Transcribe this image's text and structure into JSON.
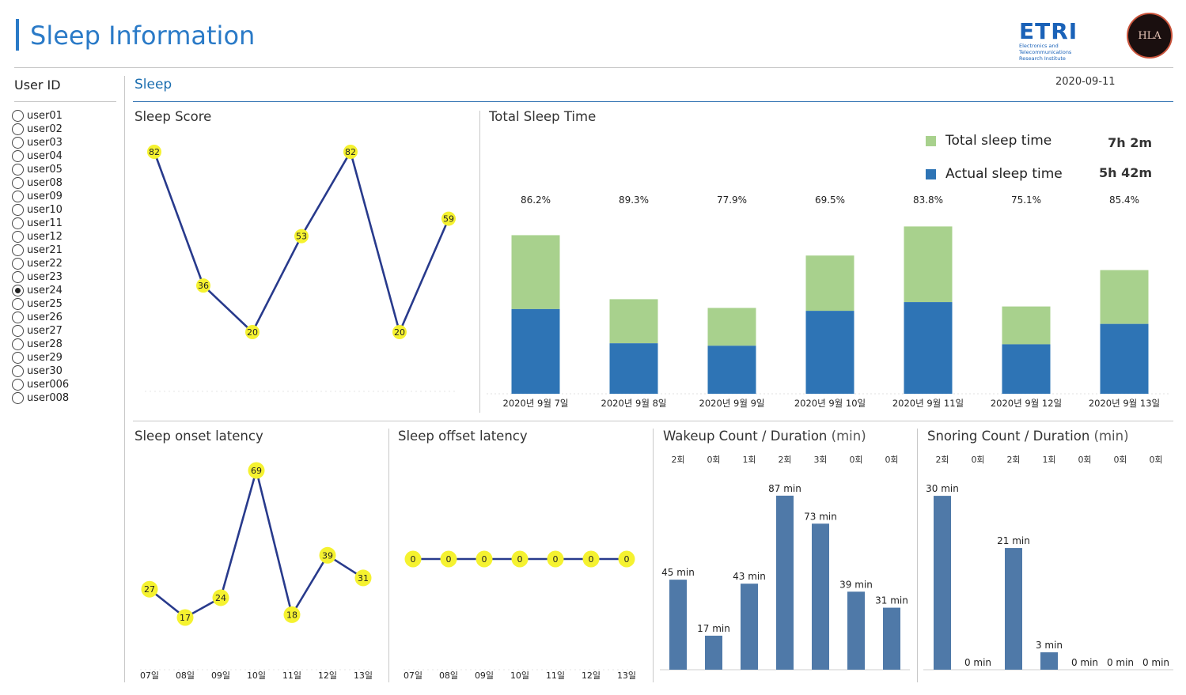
{
  "header": {
    "title": "Sleep Information",
    "logo_text": "ETRI",
    "logo_subtitle_1": "Electronics and Telecommunications",
    "logo_subtitle_2": "Research Institute",
    "brand_mark": "HLA"
  },
  "sidebar": {
    "title": "User ID",
    "selected": "user24",
    "users": [
      "user01",
      "user02",
      "user03",
      "user04",
      "user05",
      "user08",
      "user09",
      "user10",
      "user11",
      "user12",
      "user21",
      "user22",
      "user23",
      "user24",
      "user25",
      "user26",
      "user27",
      "user28",
      "user29",
      "user30",
      "user006",
      "user008"
    ]
  },
  "main": {
    "section_label": "Sleep",
    "date": "2020-09-11"
  },
  "colors": {
    "accent": "#2a7ac7",
    "line": "#283a8c",
    "marker": "#f5f230",
    "total_sleep": "#a8d18d",
    "actual_sleep": "#2e74b5",
    "bar": "#4f79a8"
  },
  "chart_data": [
    {
      "id": "sleep_score",
      "type": "line",
      "title": "Sleep Score",
      "values": [
        82,
        36,
        20,
        53,
        82,
        20,
        59
      ]
    },
    {
      "id": "total_sleep_time",
      "type": "bar",
      "title": "Total Sleep Time",
      "categories": [
        "2020년 9월 7일",
        "2020년 9월 8일",
        "2020년 9월 9일",
        "2020년 9월 10일",
        "2020년 9월 11일",
        "2020년 9월 12일",
        "2020년 9월 13일"
      ],
      "percent_labels": [
        "86.2%",
        "89.3%",
        "77.9%",
        "69.5%",
        "83.8%",
        "75.1%",
        "85.4%"
      ],
      "series": [
        {
          "name": "Actual sleep time",
          "values": [
            5.82,
            3.47,
            3.3,
            5.7,
            6.3,
            3.4,
            4.8
          ]
        },
        {
          "name": "Total sleep time",
          "values": [
            10.9,
            6.5,
            5.9,
            9.5,
            11.5,
            6.0,
            8.5
          ]
        }
      ],
      "legend": [
        {
          "name": "Total sleep time",
          "value": "7h 2m"
        },
        {
          "name": "Actual sleep time",
          "value": "5h 42m"
        }
      ],
      "legend_position": "top-right"
    },
    {
      "id": "sleep_onset_latency",
      "type": "line",
      "title": "Sleep onset latency",
      "categories": [
        "07일",
        "08일",
        "09일",
        "10일",
        "11일",
        "12일",
        "13일"
      ],
      "values": [
        27,
        17,
        24,
        69,
        18,
        39,
        31
      ]
    },
    {
      "id": "sleep_offset_latency",
      "type": "line",
      "title": "Sleep offset latency",
      "categories": [
        "07일",
        "08일",
        "09일",
        "10일",
        "11일",
        "12일",
        "13일"
      ],
      "values": [
        0,
        0,
        0,
        0,
        0,
        0,
        0
      ]
    },
    {
      "id": "wakeup",
      "type": "bar",
      "title": "Wakeup Count / Duration",
      "unit": "(min)",
      "counts": [
        "2회",
        "0회",
        "1회",
        "2회",
        "3회",
        "0회",
        "0회"
      ],
      "values": [
        45,
        17,
        43,
        87,
        73,
        39,
        31
      ],
      "value_labels": [
        "45 min",
        "17 min",
        "43 min",
        "87 min",
        "73 min",
        "39 min",
        "31 min"
      ]
    },
    {
      "id": "snoring",
      "type": "bar",
      "title": "Snoring Count / Duration",
      "unit": "(min)",
      "counts": [
        "2회",
        "0회",
        "2회",
        "1회",
        "0회",
        "0회",
        "0회"
      ],
      "values": [
        30,
        0,
        21,
        3,
        0,
        0,
        0
      ],
      "value_labels": [
        "30 min",
        "0 min",
        "21 min",
        "3 min",
        "0 min",
        "0 min",
        "0 min"
      ]
    }
  ]
}
